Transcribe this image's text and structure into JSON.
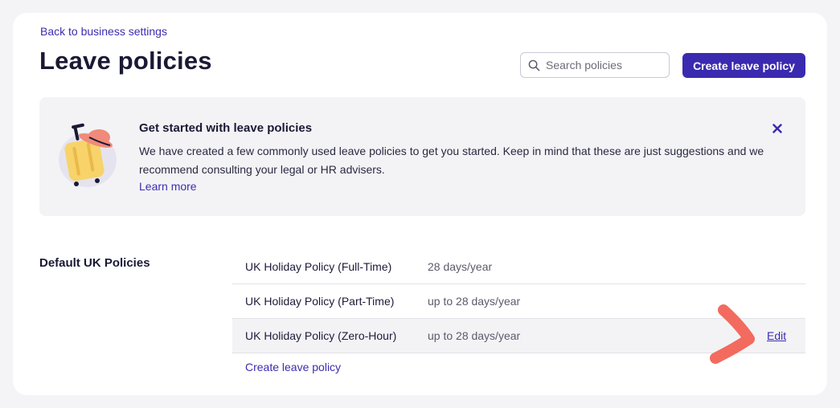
{
  "header": {
    "back_link": "Back to business settings",
    "title": "Leave policies",
    "search_placeholder": "Search policies",
    "create_button": "Create leave policy"
  },
  "banner": {
    "title": "Get started with leave policies",
    "body": "We have created a few commonly used leave policies to get you started. Keep in mind that these are just suggestions and we recommend consulting your legal or HR advisers.",
    "learn_more": "Learn more",
    "illustration": "suitcase-hat-illustration",
    "close_icon": "close-icon"
  },
  "section": {
    "label": "Default UK Policies",
    "policies": [
      {
        "name": "UK Holiday Policy (Full-Time)",
        "allowance": "28 days/year",
        "edit": ""
      },
      {
        "name": "UK Holiday Policy (Part-Time)",
        "allowance": "up to 28 days/year",
        "edit": ""
      },
      {
        "name": "UK Holiday Policy (Zero-Hour)",
        "allowance": "up to 28 days/year",
        "edit": "Edit"
      }
    ],
    "create_link": "Create leave policy"
  },
  "colors": {
    "accent": "#3a2ab0",
    "link": "#3b2db0",
    "annotation": "#f26b5e",
    "banner_bg": "#f3f3f6"
  }
}
